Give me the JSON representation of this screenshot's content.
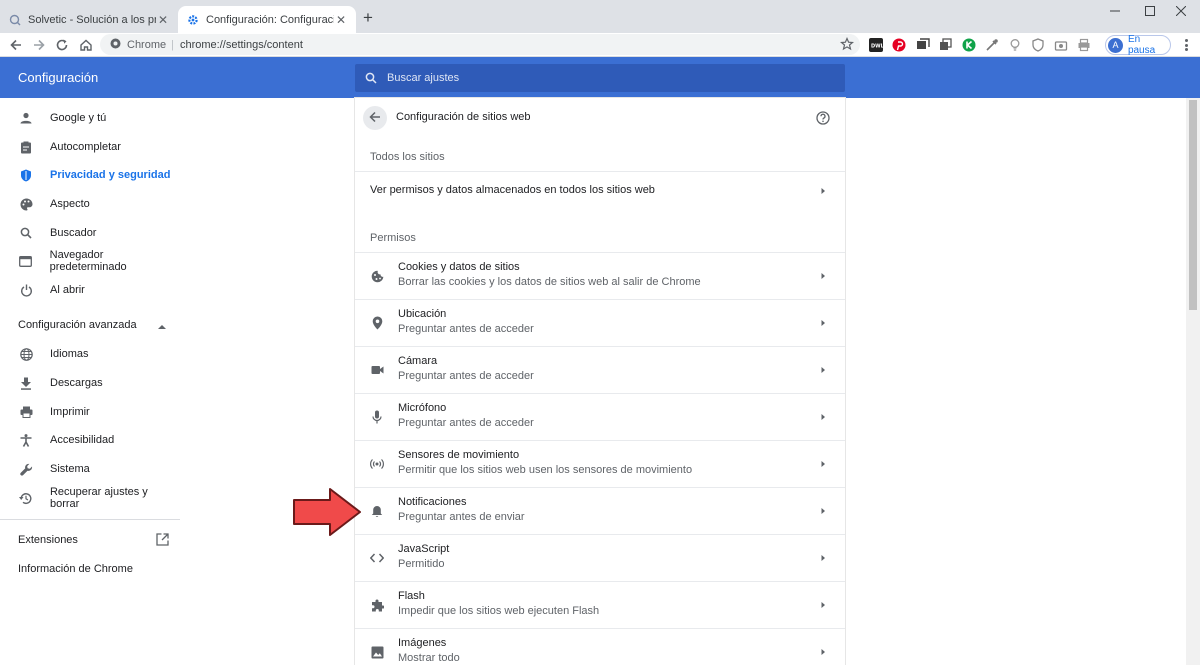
{
  "browser": {
    "tabs": [
      {
        "title": "Solvetic - Solución a los problemas",
        "active": false
      },
      {
        "title": "Configuración: Configuración de sitios web",
        "active": true
      }
    ],
    "chip": "Chrome",
    "url": "chrome://settings/content",
    "profile_initial": "A",
    "profile_label": "En pausa",
    "extensions": [
      "dwl-icon",
      "pinterest-icon",
      "tab-manager-icon",
      "tab-copy-icon",
      "k-extension-icon",
      "eyedropper-icon",
      "lightbulb-icon",
      "shield-extension-icon",
      "camera-extension-icon",
      "print-extension-icon"
    ]
  },
  "header": {
    "title": "Configuración",
    "search_placeholder": "Buscar ajustes"
  },
  "sidebar": {
    "items": [
      {
        "label": "Google y tú",
        "icon": "person-icon"
      },
      {
        "label": "Autocompletar",
        "icon": "clipboard-icon"
      },
      {
        "label": "Privacidad y seguridad",
        "icon": "shield-icon",
        "active": true
      },
      {
        "label": "Aspecto",
        "icon": "palette-icon"
      },
      {
        "label": "Buscador",
        "icon": "search-icon"
      },
      {
        "label": "Navegador predeterminado",
        "icon": "browser-icon"
      },
      {
        "label": "Al abrir",
        "icon": "power-icon"
      }
    ],
    "advanced_label": "Configuración avanzada",
    "advanced_items": [
      {
        "label": "Idiomas",
        "icon": "globe-icon"
      },
      {
        "label": "Descargas",
        "icon": "download-icon"
      },
      {
        "label": "Imprimir",
        "icon": "printer-icon"
      },
      {
        "label": "Accesibilidad",
        "icon": "accessibility-icon"
      },
      {
        "label": "Sistema",
        "icon": "wrench-icon"
      },
      {
        "label": "Recuperar ajustes y borrar",
        "icon": "restore-icon"
      }
    ],
    "extensions_label": "Extensiones",
    "about_label": "Información de Chrome"
  },
  "main": {
    "title": "Configuración de sitios web",
    "all_sites_section": "Todos los sitios",
    "all_sites_row": "Ver permisos y datos almacenados en todos los sitios web",
    "permissions_section": "Permisos",
    "permissions": [
      {
        "title": "Cookies y datos de sitios",
        "subtitle": "Borrar las cookies y los datos de sitios web al salir de Chrome",
        "icon": "cookie-icon"
      },
      {
        "title": "Ubicación",
        "subtitle": "Preguntar antes de acceder",
        "icon": "location-icon"
      },
      {
        "title": "Cámara",
        "subtitle": "Preguntar antes de acceder",
        "icon": "camera-icon"
      },
      {
        "title": "Micrófono",
        "subtitle": "Preguntar antes de acceder",
        "icon": "microphone-icon"
      },
      {
        "title": "Sensores de movimiento",
        "subtitle": "Permitir que los sitios web usen los sensores de movimiento",
        "icon": "sensors-icon"
      },
      {
        "title": "Notificaciones",
        "subtitle": "Preguntar antes de enviar",
        "icon": "bell-icon"
      },
      {
        "title": "JavaScript",
        "subtitle": "Permitido",
        "icon": "code-icon"
      },
      {
        "title": "Flash",
        "subtitle": "Impedir que los sitios web ejecuten Flash",
        "icon": "puzzle-icon"
      },
      {
        "title": "Imágenes",
        "subtitle": "Mostrar todo",
        "icon": "image-icon"
      }
    ]
  },
  "colors": {
    "header": "#3b6fd3",
    "search": "#2f5bb8",
    "active": "#1a73e8",
    "annotation_arrow": "#f04a4a"
  }
}
